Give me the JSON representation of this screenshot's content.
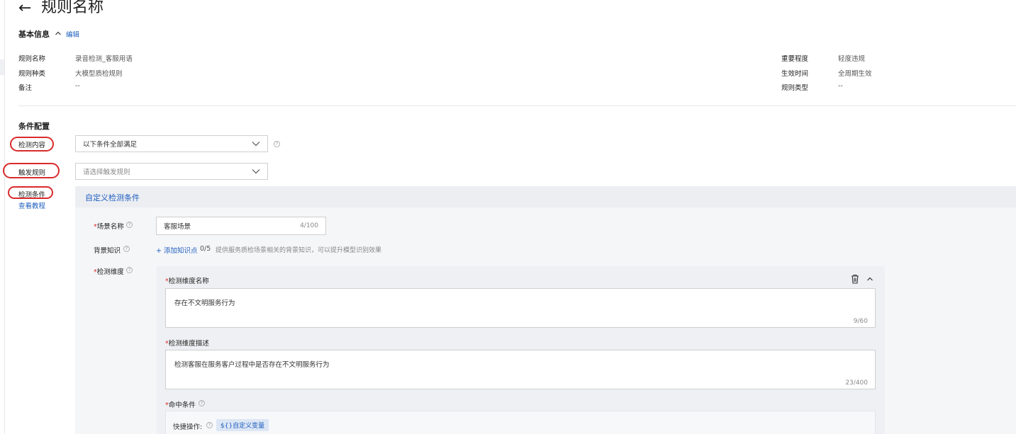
{
  "header": {
    "back_icon": "arrow-left-icon",
    "title": "规则名称"
  },
  "basic_info": {
    "title": "基本信息",
    "collapse_icon": "chevron-up-icon",
    "edit_label": "编辑",
    "left_fields": [
      {
        "label": "规则名称",
        "value": "录音检测_客服用语"
      },
      {
        "label": "规则种类",
        "value": "大模型质检规则"
      },
      {
        "label": "备注",
        "value": "--"
      }
    ],
    "right_fields": [
      {
        "label": "重要程度",
        "value": "轻度违规"
      },
      {
        "label": "生效时间",
        "value": "全周期生效"
      },
      {
        "label": "规则类型",
        "value": "--"
      }
    ]
  },
  "conditions": {
    "title": "条件配置",
    "detect_content": {
      "label": "检测内容",
      "value": "以下条件全部满足"
    },
    "trigger_rule": {
      "label": "触发规则",
      "placeholder": "请选择触发规则"
    },
    "detect_condition": {
      "label": "检测条件",
      "tutorial_link": "查看教程"
    },
    "custom_panel": {
      "title": "自定义检测条件",
      "scene_name": {
        "label": "场景名称",
        "value": "客服场景",
        "counter": "4/100"
      },
      "background": {
        "label": "背景知识",
        "add_label": "+ 添加知识点",
        "count": "0/5",
        "hint": "提供服务质检场景相关的背景知识，可以提升模型识别效果"
      },
      "dimension": {
        "label": "检测维度",
        "name_label": "检测维度名称",
        "name_value": "存在不文明服务行为",
        "name_counter": "9/60",
        "desc_label": "检测维度描述",
        "desc_value": "检测客服在服务客户过程中是否存在不文明服务行为",
        "desc_counter": "23/400",
        "hit_label": "命中条件",
        "quick_label": "快捷操作:",
        "var_tag": "${}自定义变量"
      }
    }
  },
  "colors": {
    "accent": "#1f5fbf",
    "annotation": "#d92b2b",
    "panel_bg": "#f5f6f8"
  }
}
